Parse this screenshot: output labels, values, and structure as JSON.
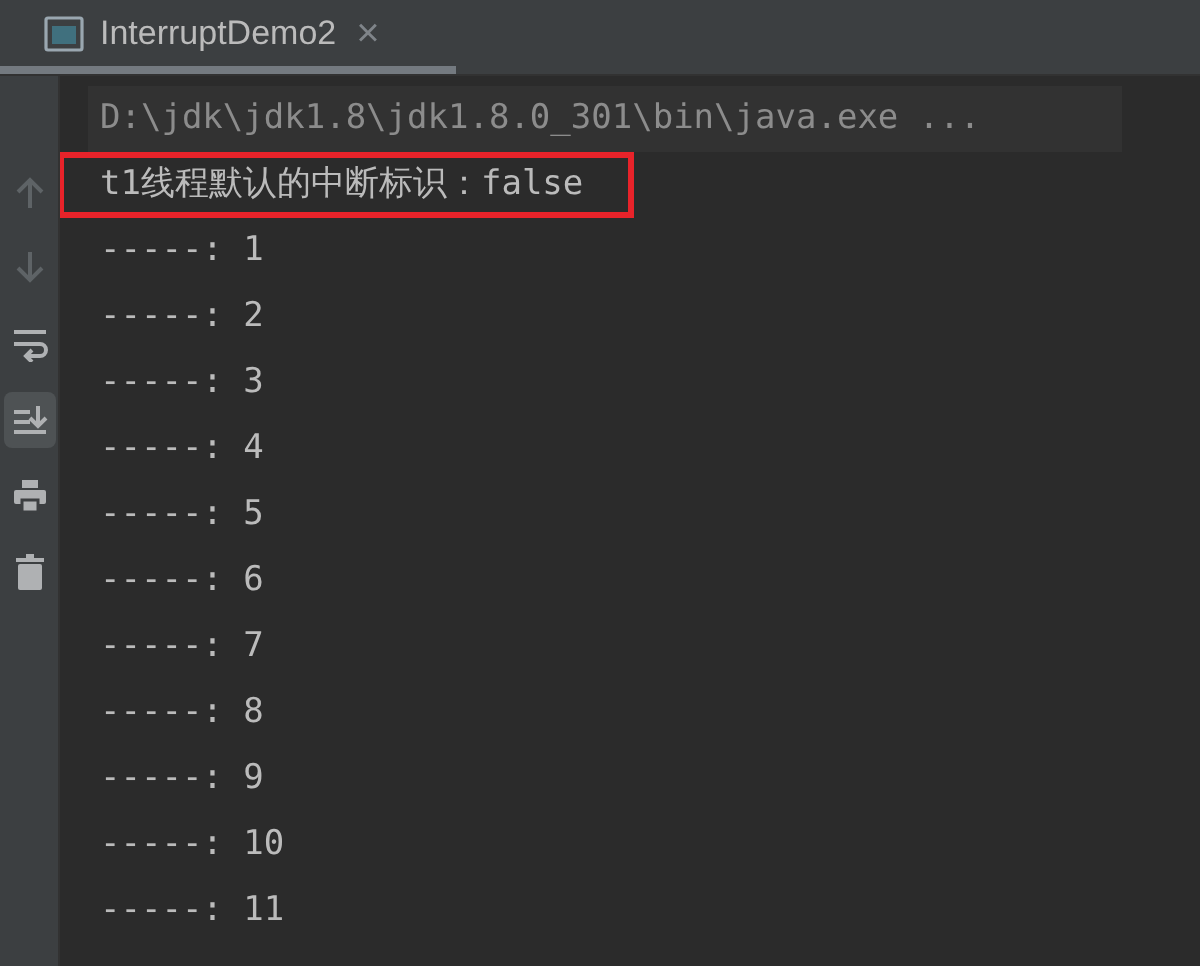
{
  "tabs": [
    {
      "title": "InterruptDemo2",
      "selected": true,
      "close": "×"
    }
  ],
  "toolbar": [
    {
      "kind": "up",
      "selected": false
    },
    {
      "kind": "down",
      "selected": false
    },
    {
      "kind": "wrap",
      "selected": false
    },
    {
      "kind": "scroll-end",
      "selected": true
    },
    {
      "kind": "print",
      "selected": false
    },
    {
      "kind": "trash",
      "selected": false
    }
  ],
  "console": [
    {
      "kind": "command",
      "text": "D:\\jdk\\jdk1.8\\jdk1.8.0_301\\bin\\java.exe ...",
      "boxed": false
    },
    {
      "kind": "output",
      "text": "t1线程默认的中断标识：false",
      "boxed": true
    },
    {
      "kind": "output",
      "text": "-----: 1",
      "boxed": false
    },
    {
      "kind": "output",
      "text": "-----: 2",
      "boxed": false
    },
    {
      "kind": "output",
      "text": "-----: 3",
      "boxed": false
    },
    {
      "kind": "output",
      "text": "-----: 4",
      "boxed": false
    },
    {
      "kind": "output",
      "text": "-----: 5",
      "boxed": false
    },
    {
      "kind": "output",
      "text": "-----: 6",
      "boxed": false
    },
    {
      "kind": "output",
      "text": "-----: 7",
      "boxed": false
    },
    {
      "kind": "output",
      "text": "-----: 8",
      "boxed": false
    },
    {
      "kind": "output",
      "text": "-----: 9",
      "boxed": false
    },
    {
      "kind": "output",
      "text": "-----: 10",
      "boxed": false
    },
    {
      "kind": "output",
      "text": "-----: 11",
      "boxed": false
    }
  ]
}
